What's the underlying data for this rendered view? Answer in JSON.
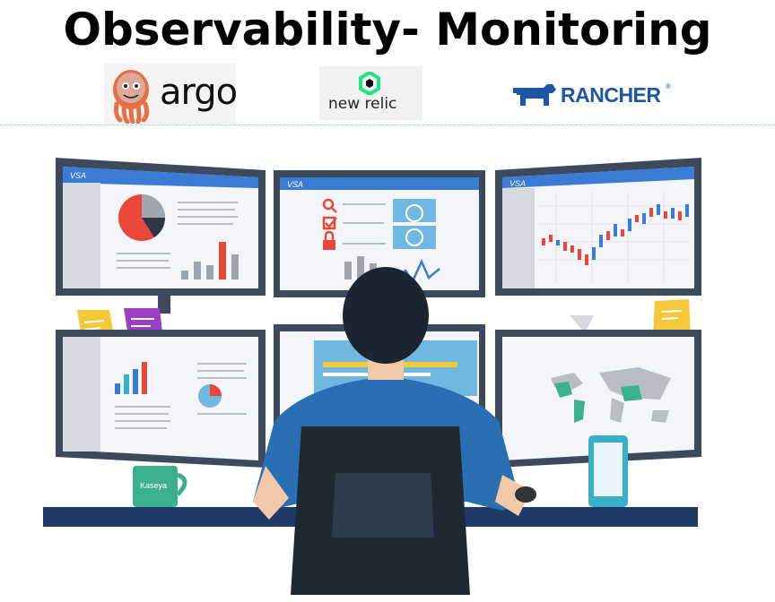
{
  "title": "Observability- Monitoring",
  "logos": {
    "argo": {
      "name": "argo",
      "icon": "octopus-mascot-icon",
      "color": "#e96d46"
    },
    "newrelic": {
      "name": "new relic",
      "icon": "new-relic-hexagon-icon",
      "color": "#1ce783"
    },
    "rancher": {
      "name": "RANCHER",
      "icon": "rancher-cow-icon",
      "color": "#1c57a5",
      "mark": "®"
    }
  },
  "monitors": {
    "screen_tag": "VSA",
    "mug_label": "Kaseya",
    "accent": "#3a7bd5",
    "frame": "#3d4a5c"
  }
}
